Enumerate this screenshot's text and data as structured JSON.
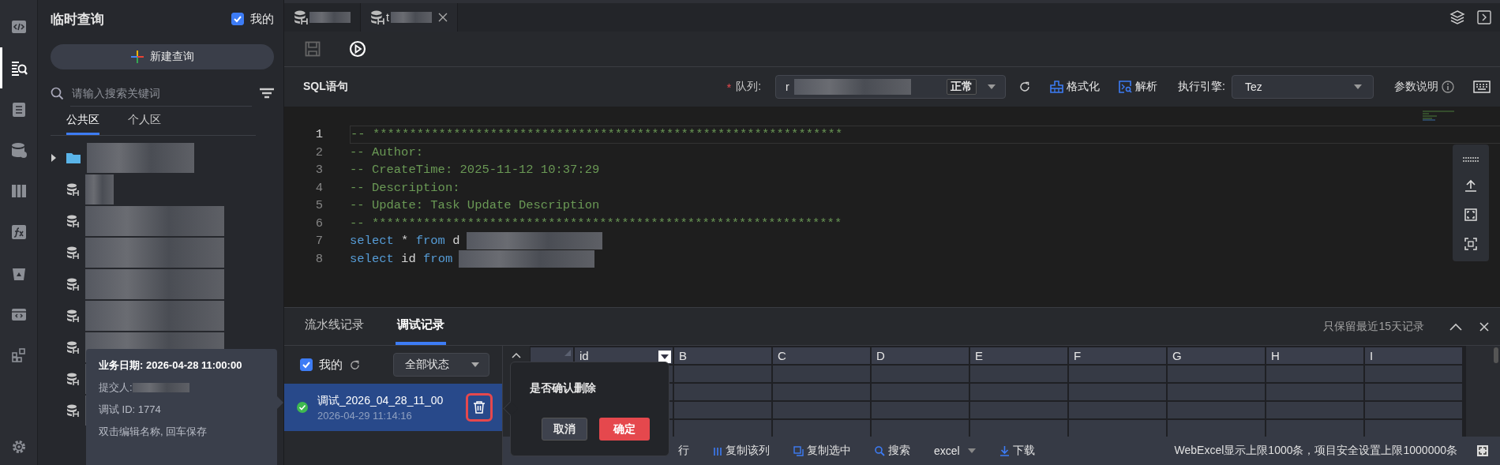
{
  "rail": {
    "items": [
      {
        "kind": "code",
        "selected": false
      },
      {
        "kind": "query",
        "selected": true
      },
      {
        "kind": "clipboard",
        "selected": false
      },
      {
        "kind": "database",
        "selected": false
      },
      {
        "kind": "columns",
        "selected": false
      },
      {
        "kind": "function",
        "selected": false
      },
      {
        "kind": "recycle",
        "selected": false
      },
      {
        "kind": "script",
        "selected": false
      },
      {
        "kind": "apps",
        "selected": false
      }
    ],
    "settings": {
      "kind": "gear"
    }
  },
  "sidebar": {
    "title": "临时查询",
    "mine_filter": {
      "label": "我的",
      "checked": true
    },
    "new_button": "新建查询",
    "search": {
      "placeholder": "请输入搜索关键词"
    },
    "tabs": [
      {
        "label": "公共区",
        "selected": true
      },
      {
        "label": "个人区",
        "selected": false
      }
    ],
    "tree": [
      {
        "kind": "folder",
        "expanded": false
      },
      {
        "kind": "table"
      },
      {
        "kind": "table"
      },
      {
        "kind": "table"
      },
      {
        "kind": "table"
      },
      {
        "kind": "table"
      },
      {
        "kind": "table"
      },
      {
        "kind": "table"
      },
      {
        "kind": "table"
      }
    ]
  },
  "editor_tabs": [
    {
      "selected": false,
      "closable": false
    },
    {
      "label": "t",
      "selected": true,
      "closable": true
    }
  ],
  "sql_bar": {
    "title": "SQL语句",
    "queue": {
      "required": true,
      "label": "队列:",
      "value": "r",
      "status": "正常"
    },
    "format": "格式化",
    "parse": "解析",
    "engine": {
      "label": "执行引擎:",
      "value": "Tez"
    },
    "params": "参数说明"
  },
  "code_lines": [
    {
      "number": "1",
      "active": true,
      "tokens": [
        {
          "kind": "comment",
          "text": "-- ****************************************************************"
        }
      ]
    },
    {
      "number": "2",
      "active": false,
      "tokens": [
        {
          "kind": "comment",
          "text": "-- Author:"
        }
      ]
    },
    {
      "number": "3",
      "active": false,
      "tokens": [
        {
          "kind": "comment",
          "text": "-- CreateTime: 2025-11-12 10:37:29"
        }
      ]
    },
    {
      "number": "4",
      "active": false,
      "tokens": [
        {
          "kind": "comment",
          "text": "-- Description:"
        }
      ]
    },
    {
      "number": "5",
      "active": false,
      "tokens": [
        {
          "kind": "comment",
          "text": "-- Update: Task Update Description"
        }
      ]
    },
    {
      "number": "6",
      "active": false,
      "tokens": [
        {
          "kind": "comment",
          "text": "-- ****************************************************************"
        }
      ]
    },
    {
      "number": "7",
      "active": false,
      "tokens": [
        {
          "kind": "keyword",
          "text": "select"
        },
        {
          "kind": "plain",
          "text": " * "
        },
        {
          "kind": "keyword",
          "text": "from"
        },
        {
          "kind": "plain",
          "text": " d"
        },
        {
          "kind": "redacted"
        }
      ]
    },
    {
      "number": "8",
      "active": false,
      "tokens": [
        {
          "kind": "keyword",
          "text": "select"
        },
        {
          "kind": "plain",
          "text": " id "
        },
        {
          "kind": "keyword",
          "text": "from"
        },
        {
          "kind": "redacted"
        }
      ]
    }
  ],
  "bottom_panel": {
    "tabs": [
      {
        "label": "流水线记录",
        "selected": false
      },
      {
        "label": "调试记录",
        "selected": true
      }
    ],
    "note": "只保留最近15天记录",
    "mine_filter": {
      "label": "我的",
      "checked": true
    },
    "status_filter": "全部状态",
    "records": [
      {
        "name": "调试_2026_04_28_11_00",
        "time": "2026-04-29 11:14:16",
        "succeeded": true,
        "selected": true
      }
    ],
    "grid": {
      "columns": [
        "id",
        "B",
        "C",
        "D",
        "E",
        "F",
        "G",
        "H",
        "I"
      ]
    }
  },
  "footer": {
    "actions": [
      {
        "kind": "text",
        "label": "行"
      },
      {
        "kind": "copy-column",
        "label": "复制该列"
      },
      {
        "kind": "copy-selection",
        "label": "复制选中"
      },
      {
        "kind": "search",
        "label": "搜索"
      }
    ],
    "format": "excel",
    "download": "下载",
    "limit_note": "WebExcel显示上限1000条，项目安全设置上限1000000条"
  },
  "tooltip": {
    "title": "业务日期: 2026-04-28 11:00:00",
    "submitter": "提交人:",
    "debug_id": "调试 ID: 1774",
    "hint": "双击编辑名称, 回车保存"
  },
  "confirm": {
    "message": "是否确认删除",
    "cancel": "取消",
    "ok": "确定"
  }
}
